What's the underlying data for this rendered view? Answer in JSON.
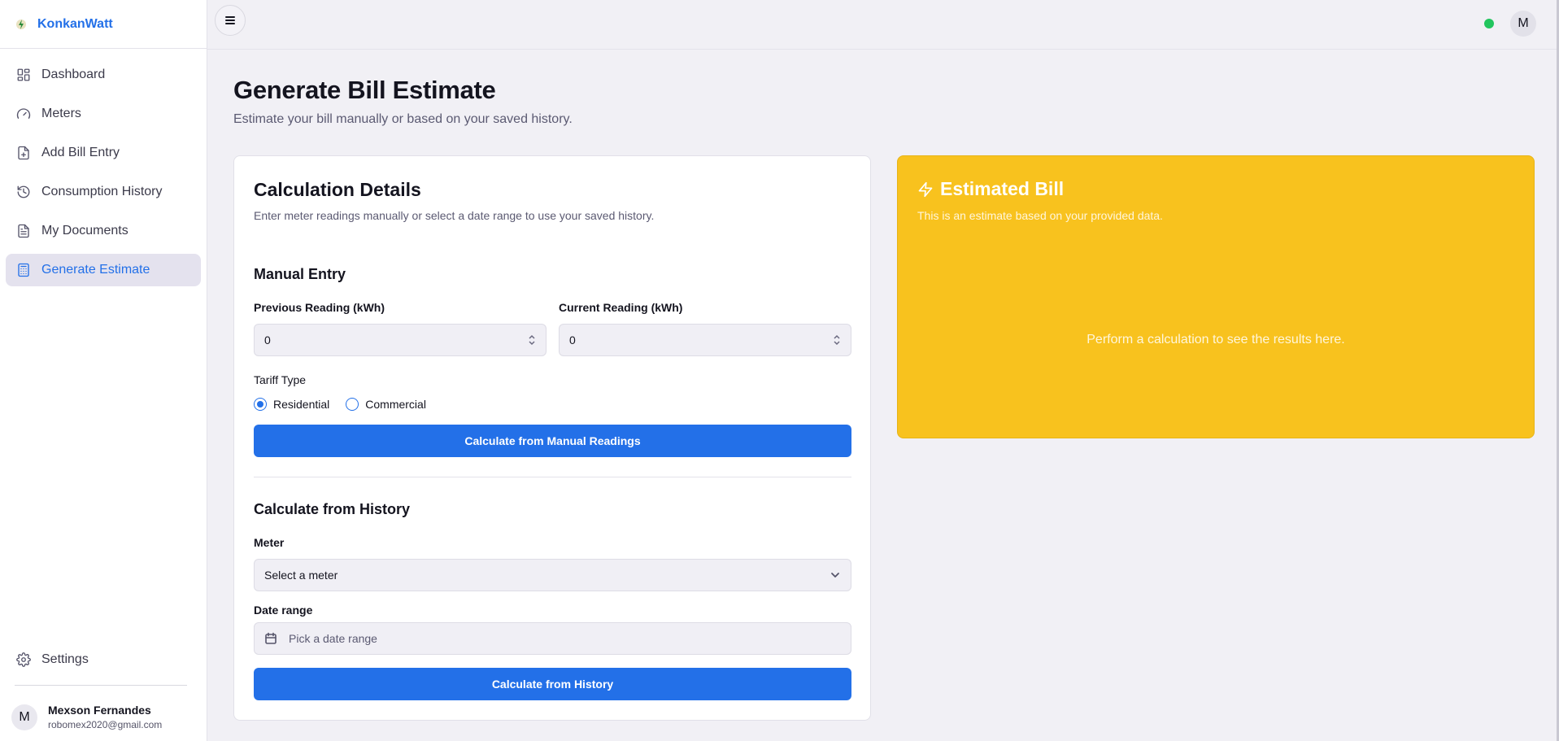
{
  "app": {
    "name": "KonkanWatt"
  },
  "sidebar": {
    "items": [
      {
        "label": "Dashboard",
        "icon": "dashboard-icon"
      },
      {
        "label": "Meters",
        "icon": "gauge-icon"
      },
      {
        "label": "Add Bill Entry",
        "icon": "file-plus-icon"
      },
      {
        "label": "Consumption History",
        "icon": "history-icon"
      },
      {
        "label": "My Documents",
        "icon": "document-icon"
      },
      {
        "label": "Generate Estimate",
        "icon": "calculator-icon",
        "active": true
      }
    ],
    "settings_label": "Settings",
    "user": {
      "initial": "M",
      "name": "Mexson Fernandes",
      "email": "robomex2020@gmail.com"
    }
  },
  "header": {
    "avatar_initial": "M",
    "status_color": "#22c55e"
  },
  "page": {
    "title": "Generate Bill Estimate",
    "subtitle": "Estimate your bill manually or based on your saved history."
  },
  "calc": {
    "title": "Calculation Details",
    "subtitle": "Enter meter readings manually or select a date range to use your saved history.",
    "manual": {
      "title": "Manual Entry",
      "prev_label": "Previous Reading (kWh)",
      "prev_value": "0",
      "curr_label": "Current Reading (kWh)",
      "curr_value": "0",
      "tariff_label": "Tariff Type",
      "tariff_options": [
        "Residential",
        "Commercial"
      ],
      "tariff_selected": "Residential",
      "button": "Calculate from Manual Readings"
    },
    "history": {
      "title": "Calculate from History",
      "meter_label": "Meter",
      "meter_placeholder": "Select a meter",
      "date_label": "Date range",
      "date_placeholder": "Pick a date range",
      "button": "Calculate from History"
    }
  },
  "estimate": {
    "title": "Estimated Bill",
    "subtitle": "This is an estimate based on your provided data.",
    "empty_message": "Perform a calculation to see the results here.",
    "color": "#f8c21e"
  },
  "colors": {
    "accent": "#2370e8"
  }
}
